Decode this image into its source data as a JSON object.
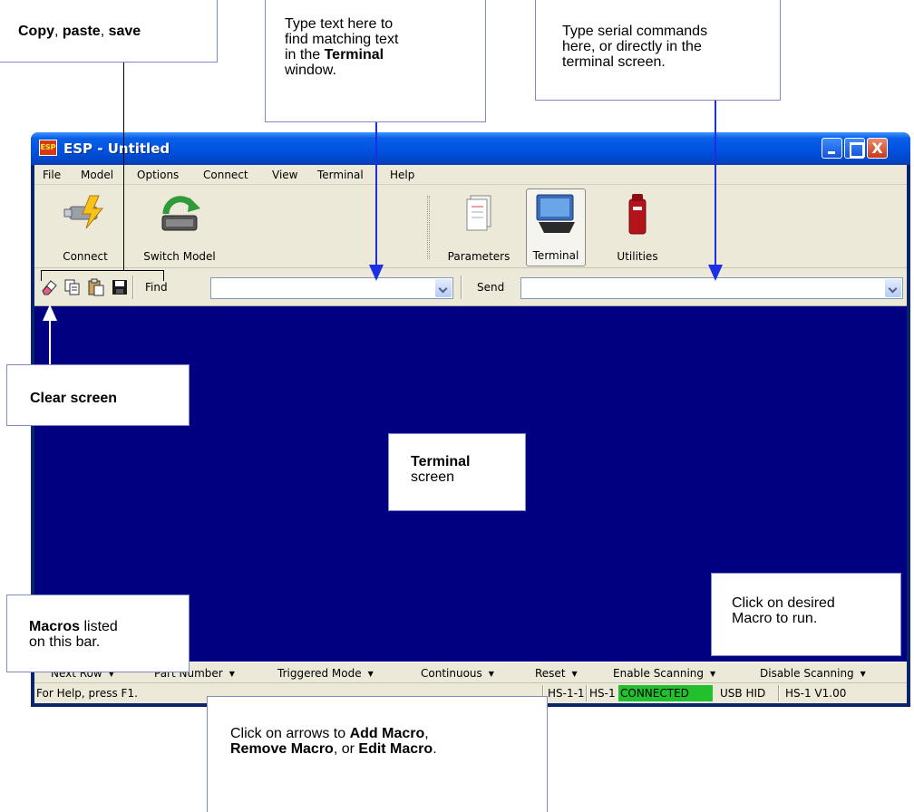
{
  "window": {
    "title": "ESP - Untitled",
    "app_icon_text": "ESP",
    "close_glyph": "X"
  },
  "menu": [
    "File",
    "Model",
    "Options",
    "Connect",
    "View",
    "Terminal",
    "Help"
  ],
  "toolbar": {
    "connect_label": "Connect",
    "switch_model_label": "Switch Model",
    "parameters_label": "Parameters",
    "terminal_label": "Terminal",
    "utilities_label": "Utilities"
  },
  "small_toolbar": {
    "icons": [
      "eraser-icon",
      "copy-icon",
      "paste-icon",
      "save-icon"
    ],
    "find_label": "Find",
    "find_value": "",
    "send_label": "Send",
    "send_value": ""
  },
  "macros": [
    {
      "label": "Next Row"
    },
    {
      "label": "Part Number"
    },
    {
      "label": "Triggered Mode"
    },
    {
      "label": "Continuous"
    },
    {
      "label": "Reset"
    },
    {
      "label": "Enable Scanning"
    },
    {
      "label": "Disable Scanning"
    }
  ],
  "macro_dropdown_glyph": "▼",
  "status": {
    "help_text": "For Help, press F1.",
    "code1": "HS-1-1",
    "code2": "HS-1",
    "connection": "CONNECTED",
    "interface": "USB HID",
    "version": "HS-1 V1.00"
  },
  "colors": {
    "terminal_bg": "#000080",
    "connected_bg": "#22c02e",
    "callout_arrow": "#1c2fe5",
    "titlebar": "#0054e3"
  },
  "callouts": {
    "copy_paste_save": {
      "bold1": "Copy",
      "sep1": ", ",
      "bold2": "paste",
      "sep2": ", ",
      "bold3": "save"
    },
    "find": {
      "line1": "Type text here to",
      "line2": "find matching text",
      "line3_pre": "in the ",
      "line3_bold": "Terminal",
      "line4": "window."
    },
    "send": {
      "line1": "Type serial commands",
      "line2": "here, or directly in the",
      "line3": "terminal screen."
    },
    "clear_screen": {
      "bold": "Clear screen"
    },
    "terminal_screen": {
      "bold": "Terminal",
      "line2": "screen"
    },
    "macros": {
      "bold": "Macros",
      "rest1": " listed",
      "line2": "on this bar."
    },
    "click_macro": {
      "line1": "Click on desired",
      "line2": "Macro to run."
    },
    "arrows": {
      "pre": "Click on arrows to ",
      "bold1": "Add Macro",
      "sep": ",",
      "bold2": "Remove Macro",
      "mid": ", or ",
      "bold3": "Edit Macro",
      "end": "."
    }
  }
}
